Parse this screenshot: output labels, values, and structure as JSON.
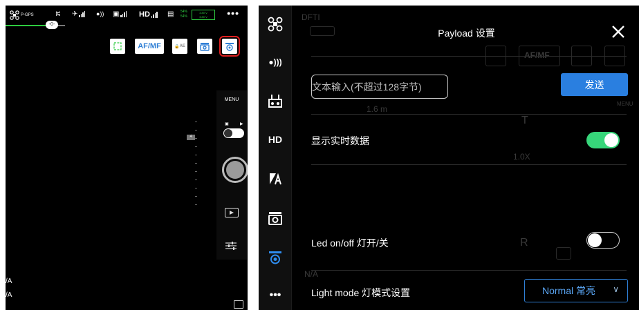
{
  "left_screen": {
    "status": {
      "gps_label": "P-GPS",
      "hd_label": "HD",
      "battery_pct_1": "54%",
      "battery_pct_2": "54%",
      "battery_v1": "3.80 V",
      "battery_v2": "3.80 V",
      "more": "•••"
    },
    "slider_knob": "-0-",
    "toolbar": {
      "focus_box": "▢",
      "af_mf": "AF/MF",
      "ae_lock": "AE",
      "camera_settings": "camera-icon",
      "payload_settings": "gear-camera-icon"
    },
    "camera_panel": {
      "menu_label": "MENU"
    },
    "zoom_mark": "4",
    "left_edge_1": "/A",
    "left_edge_2": "/A"
  },
  "side_nav": {
    "items": [
      {
        "name": "drone",
        "glyph": "✣"
      },
      {
        "name": "signal",
        "glyph": "●)))"
      },
      {
        "name": "remote",
        "glyph": "▣"
      },
      {
        "name": "hd",
        "glyph": "HD"
      },
      {
        "name": "battery",
        "glyph": "◢A"
      },
      {
        "name": "camera",
        "glyph": "◙"
      },
      {
        "name": "payload",
        "glyph": "⚙"
      },
      {
        "name": "more",
        "glyph": "•••"
      }
    ]
  },
  "payload_panel": {
    "title": "Payload 设置",
    "text_input_placeholder": "文本输入(不超过128字节)",
    "send_label": "发送",
    "realtime_label": "显示实时数据",
    "realtime_on": true,
    "led_label": "Led on/off 灯开/关",
    "led_on": false,
    "light_mode_label": "Light mode 灯模式设置",
    "light_mode_value": "Normal 常亮"
  },
  "background_ghost": {
    "dfti": "DFTI",
    "af_mf": "AF/MF",
    "distance": "1.6 m",
    "t": "T",
    "zoom": "1.0X",
    "menu": "MENU",
    "r": "R",
    "na": "N/A"
  },
  "colors": {
    "accent_blue": "#2a7fe0",
    "switch_green": "#37d67a",
    "status_green": "#2ecc40",
    "highlight_red": "#e01f1f"
  }
}
